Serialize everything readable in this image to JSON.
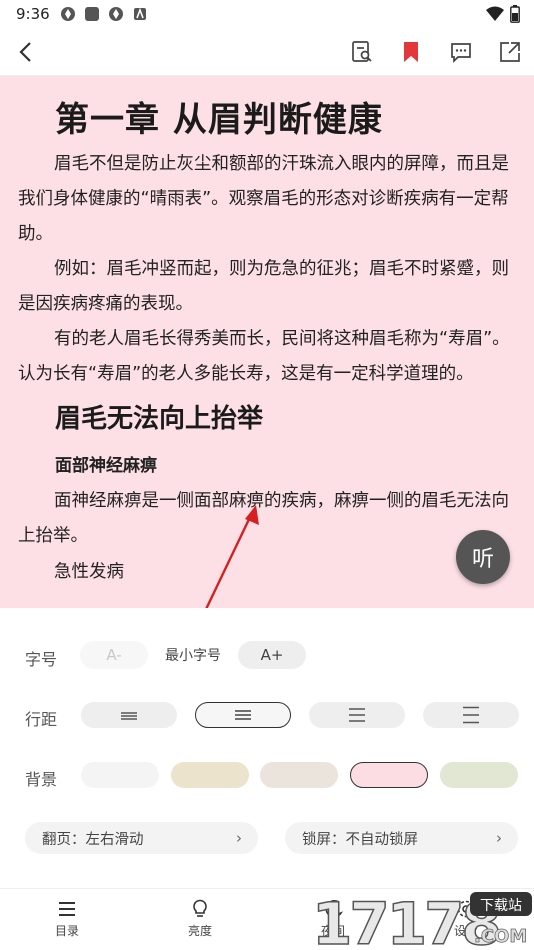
{
  "status": {
    "time": "9:36"
  },
  "toolbar": {
    "back": "back",
    "icons": [
      "search-in-page-icon",
      "bookmark-icon",
      "comment-icon",
      "share-icon"
    ]
  },
  "reader": {
    "chapter_title": "第一章 从眉判断健康",
    "paragraphs": [
      "眉毛不但是防止灰尘和额部的汗珠流入眼内的屏障，而且是我们身体健康的“晴雨表”。观察眉毛的形态对诊断疾病有一定帮助。",
      "例如：眉毛冲竖而起，则为危急的征兆；眉毛不时紧蹙，则是因疾病疼痛的表现。",
      "有的老人眉毛长得秀美而长，民间将这种眉毛称为“寿眉”。认为长有“寿眉”的老人多能长寿，这是有一定科学道理的。"
    ],
    "section_title": "眉毛无法向上抬举",
    "sub_title": "面部神经麻痹",
    "section_paragraph": "面神经麻痹是一侧面部麻痹的疾病，麻痹一侧的眉毛无法向上抬举。",
    "item": "急性发病",
    "listen_label": "听"
  },
  "panel": {
    "font_size": {
      "label": "字号",
      "decrease": "A-",
      "current": "最小字号",
      "increase": "A+"
    },
    "line_spacing": {
      "label": "行距"
    },
    "background": {
      "label": "背景",
      "swatches": [
        "#f4f4f4",
        "#ebe3cc",
        "#ebe4dc",
        "#fbdde3",
        "#e1e7d2"
      ],
      "selected_index": 3
    },
    "page_turn": {
      "label": "翻页：左右滑动"
    },
    "screen_lock": {
      "label": "锁屏：不自动锁屏"
    }
  },
  "bottom_nav": {
    "items": [
      {
        "label": "目录",
        "icon": "menu-icon"
      },
      {
        "label": "亮度",
        "icon": "bulb-icon"
      },
      {
        "label": "夜间",
        "icon": "moon-icon"
      },
      {
        "label": "设置",
        "icon": "settings-icon"
      }
    ]
  },
  "watermark": {
    "text": "17178",
    "tag": "下载站",
    "sub": ".COM"
  }
}
